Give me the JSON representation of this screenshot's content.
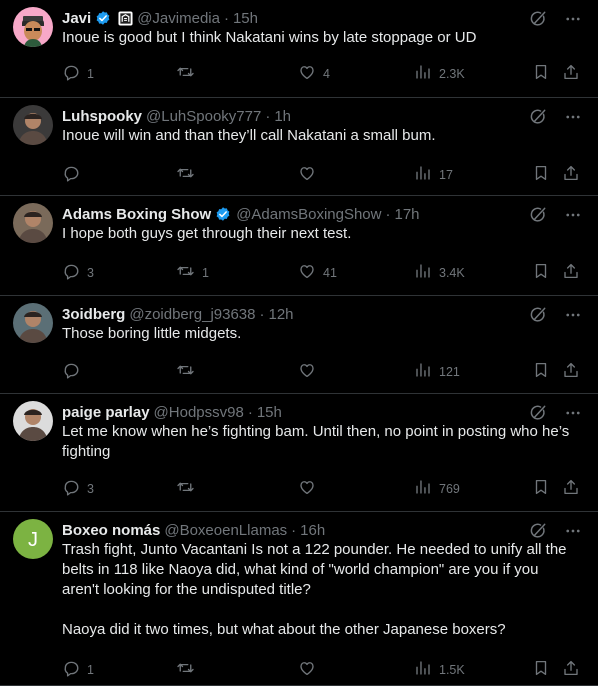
{
  "tweets": [
    {
      "name": "Javi",
      "handle": "@Javimedia",
      "time": "15h",
      "verified": true,
      "affiliate": true,
      "text": [
        "Inoue is good but I think Nakatani wins by late stoppage or UD"
      ],
      "replies": "1",
      "retweets": "",
      "likes": "4",
      "views": "2.3K",
      "avatar": {
        "type": "cartoon",
        "bg": "#f7a8c8"
      }
    },
    {
      "name": "Luhspooky",
      "handle": "@LuhSpooky777",
      "time": "1h",
      "verified": false,
      "affiliate": false,
      "text": [
        "Inoue will win and than they’ll call Nakatani a small bum."
      ],
      "replies": "",
      "retweets": "",
      "likes": "",
      "views": "17",
      "avatar": {
        "type": "photo",
        "bg": "#3b3a3a"
      }
    },
    {
      "name": "Adams Boxing Show",
      "handle": "@AdamsBoxingShow",
      "time": "17h",
      "verified": true,
      "affiliate": false,
      "text": [
        "I hope both guys get through their next test."
      ],
      "replies": "3",
      "retweets": "1",
      "likes": "41",
      "views": "3.4K",
      "avatar": {
        "type": "photo",
        "bg": "#7a6a5a"
      }
    },
    {
      "name": "3oidberg",
      "handle": "@zoidberg_j93638",
      "time": "12h",
      "verified": false,
      "affiliate": false,
      "text": [
        "Those boring little midgets."
      ],
      "replies": "",
      "retweets": "",
      "likes": "",
      "views": "121",
      "avatar": {
        "type": "photo",
        "bg": "#5b6f76"
      }
    },
    {
      "name": "paige parlay",
      "handle": "@Hodpssv98",
      "time": "15h",
      "verified": false,
      "affiliate": false,
      "text": [
        "Let me know when he’s fighting bam. Until then, no point in posting who he’s fighting"
      ],
      "replies": "3",
      "retweets": "",
      "likes": "",
      "views": "769",
      "avatar": {
        "type": "photo",
        "bg": "#dcdcdc"
      }
    },
    {
      "name": "Boxeo nomás",
      "handle": "@BoxeoenLlamas",
      "time": "16h",
      "verified": false,
      "affiliate": false,
      "text": [
        "Trash fight, Junto Vacantani Is not a 122 pounder. He needed to unify all the belts in 118 like Naoya did, what kind of \"world champion\" are you if you aren't looking for the undisputed title?",
        "Naoya did it two times, but what about the other Japanese boxers?"
      ],
      "replies": "1",
      "retweets": "",
      "likes": "",
      "views": "1.5K",
      "avatar": {
        "type": "letter",
        "letter": "J",
        "bg": "#7cb342"
      }
    }
  ],
  "colors": {
    "background": "#000000",
    "text": "#e7e9ea",
    "muted": "#71767b",
    "divider": "#2f3336",
    "verified": "#1d9bf0"
  }
}
